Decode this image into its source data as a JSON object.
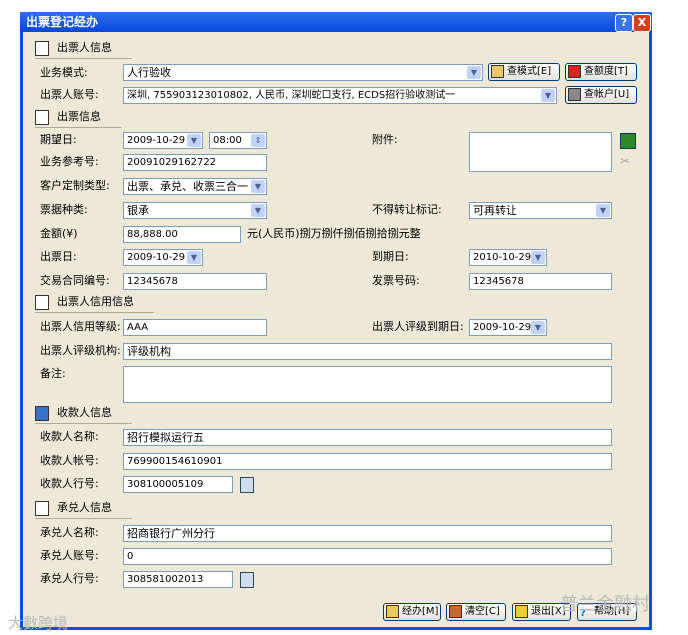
{
  "window": {
    "title": "出票登记经办",
    "help": "?",
    "close": "X"
  },
  "sections": {
    "drawer": "出票人信息",
    "bill": "出票信息",
    "credit": "出票人信用信息",
    "payee": "收款人信息",
    "acceptor": "承兑人信息"
  },
  "drawer": {
    "mode_label": "业务模式:",
    "mode_value": "人行验收",
    "account_label": "出票人账号:",
    "account_value": "深圳, 755903123010802, 人民币, 深圳蛇口支行, ECDS招行验收测试一",
    "query_mode": "查模式[E]",
    "query_limit": "查额度[T]",
    "query_account": "查帐户[U]"
  },
  "bill": {
    "expect_label": "期望日:",
    "expect_date": "2009-10-29",
    "expect_time": "08:00",
    "attach_label": "附件:",
    "ref_label": "业务参考号:",
    "ref_value": "20091029162722",
    "custom_label": "客户定制类型:",
    "custom_value": "出票、承兑、收票三合一",
    "kind_label": "票据种类:",
    "kind_value": "银承",
    "transfer_label": "不得转让标记:",
    "transfer_value": "可再转让",
    "amount_label": "金额(¥)",
    "amount_value": "88,888.00",
    "amount_words": "元(人民币)捌万捌仟捌佰捌拾捌元整",
    "issue_label": "出票日:",
    "issue_value": "2009-10-29",
    "due_label": "到期日:",
    "due_value": "2010-10-29",
    "contract_label": "交易合同编号:",
    "contract_value": "12345678",
    "invoice_label": "发票号码:",
    "invoice_value": "12345678"
  },
  "credit": {
    "grade_label": "出票人信用等级:",
    "grade_value": "AAA",
    "rating_due_label": "出票人评级到期日:",
    "rating_due_value": "2009-10-29",
    "agency_label": "出票人评级机构:",
    "agency_value": "评级机构",
    "remark_label": "备注:",
    "remark_value": ""
  },
  "payee": {
    "name_label": "收款人名称:",
    "name_value": "招行模拟运行五",
    "account_label": "收款人帐号:",
    "account_value": "769900154610901",
    "bank_label": "收款人行号:",
    "bank_value": "308100005109"
  },
  "acceptor": {
    "name_label": "承兑人名称:",
    "name_value": "招商银行广州分行",
    "account_label": "承兑人账号:",
    "account_value": "0",
    "bank_label": "承兑人行号:",
    "bank_value": "308581002013"
  },
  "footer": {
    "submit": "经办[M]",
    "clear": "清空[C]",
    "exit": "退出[X]",
    "help": "帮助[H]"
  },
  "watermarks": {
    "left": "大數跨境",
    "right": "普兰金融村"
  }
}
